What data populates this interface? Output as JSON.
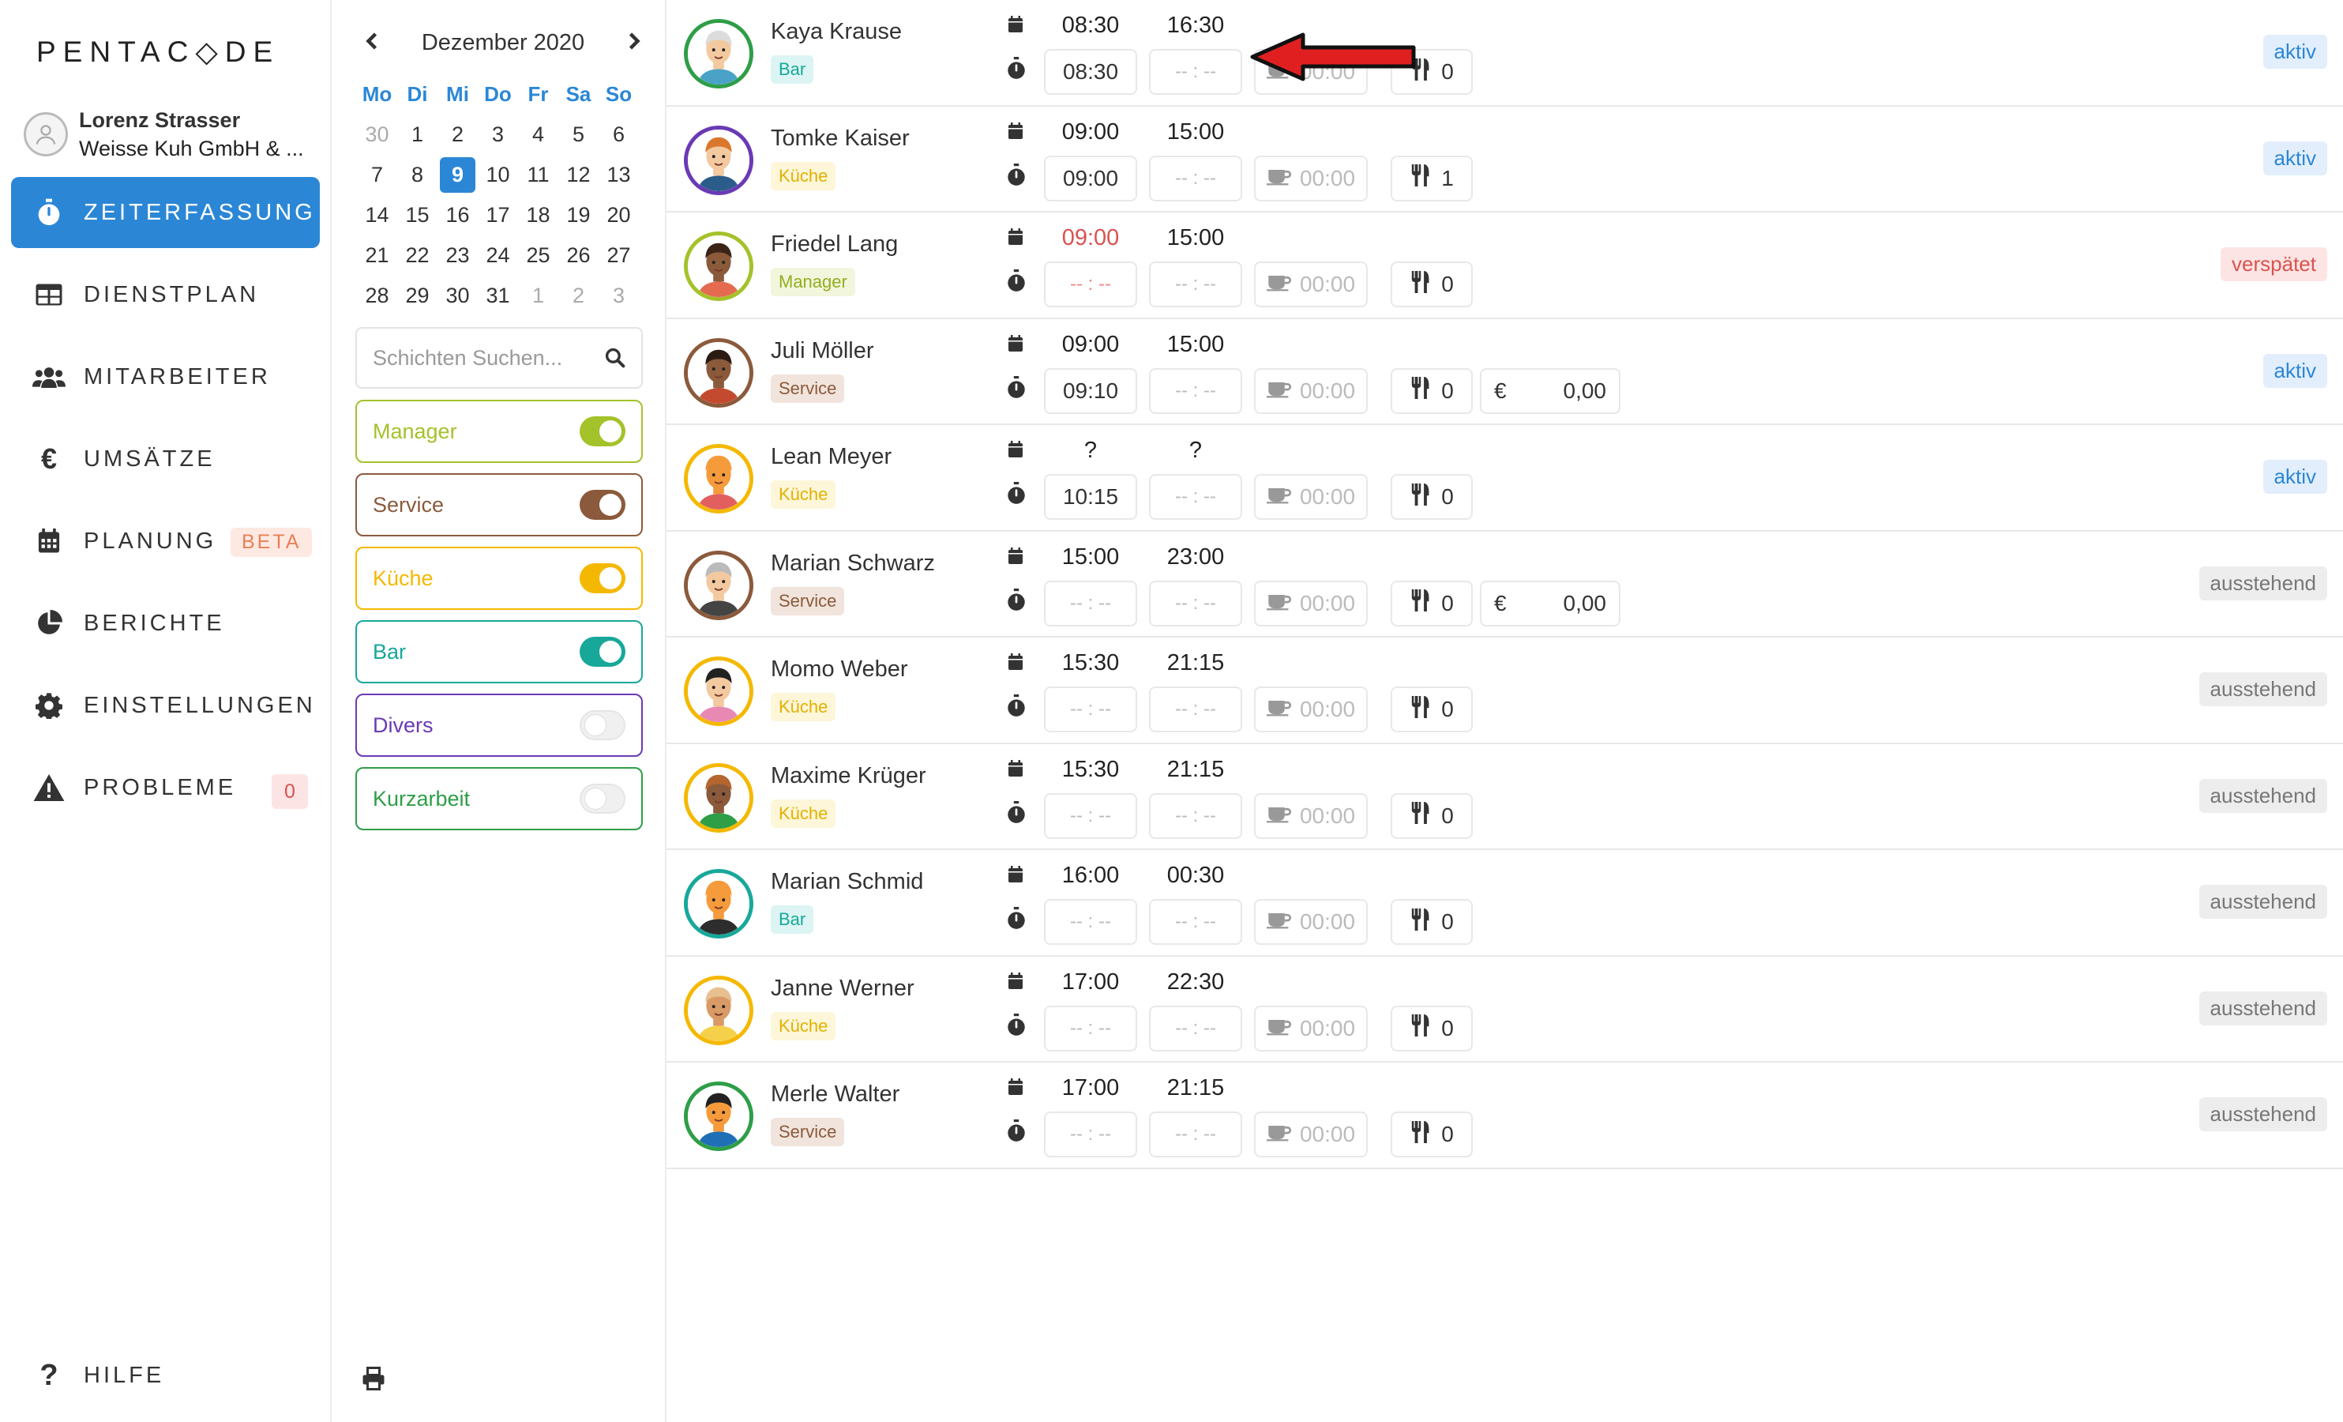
{
  "app": {
    "logo_text": "PENTAC◇DE",
    "accent_color": "#2b87d6"
  },
  "user": {
    "name": "Lorenz Strasser",
    "company": "Weisse Kuh GmbH & ..."
  },
  "nav": [
    {
      "id": "zeiterfassung",
      "label": "ZEITERFASSUNG",
      "icon": "stopwatch-icon",
      "active": true
    },
    {
      "id": "dienstplan",
      "label": "DIENSTPLAN",
      "icon": "table-icon"
    },
    {
      "id": "mitarbeiter",
      "label": "MITARBEITER",
      "icon": "users-icon"
    },
    {
      "id": "umsaetze",
      "label": "UMSÄTZE",
      "icon": "euro-icon"
    },
    {
      "id": "planung",
      "label": "PLANUNG",
      "icon": "calendar-icon",
      "badge": "BETA"
    },
    {
      "id": "berichte",
      "label": "BERICHTE",
      "icon": "pie-chart-icon"
    },
    {
      "id": "einstellungen",
      "label": "EINSTELLUNGEN",
      "icon": "gear-icon"
    },
    {
      "id": "probleme",
      "label": "PROBLEME",
      "icon": "warning-icon",
      "badge": "0"
    }
  ],
  "help": {
    "label": "HILFE",
    "icon": "question-icon"
  },
  "calendar": {
    "title": "Dezember 2020",
    "day_names": [
      "Mo",
      "Di",
      "Mi",
      "Do",
      "Fr",
      "Sa",
      "So"
    ],
    "weeks": [
      [
        "30",
        "1",
        "2",
        "3",
        "4",
        "5",
        "6"
      ],
      [
        "7",
        "8",
        "9",
        "10",
        "11",
        "12",
        "13"
      ],
      [
        "14",
        "15",
        "16",
        "17",
        "18",
        "19",
        "20"
      ],
      [
        "21",
        "22",
        "23",
        "24",
        "25",
        "26",
        "27"
      ],
      [
        "28",
        "29",
        "30",
        "31",
        "1",
        "2",
        "3"
      ]
    ],
    "selected_day": "9"
  },
  "search": {
    "placeholder": "Schichten Suchen..."
  },
  "filters": [
    {
      "label": "Manager",
      "color": "#a4c22a",
      "on": true
    },
    {
      "label": "Service",
      "color": "#8b5a3c",
      "on": true
    },
    {
      "label": "Küche",
      "color": "#f5b800",
      "on": true
    },
    {
      "label": "Bar",
      "color": "#17a89a",
      "on": true
    },
    {
      "label": "Divers",
      "color": "#6a3ab5",
      "on": false
    },
    {
      "label": "Kurzarbeit",
      "color": "#2e9e47",
      "on": false
    }
  ],
  "rows": [
    {
      "name": "Kaya Krause",
      "dept": "Bar",
      "ring": "#2e9e47",
      "plan_start": "08:30",
      "plan_end": "16:30",
      "actual_start": "08:30",
      "actual_end": "-- : --",
      "break": "00:00",
      "meals": "0",
      "status": "aktiv",
      "status_type": "aktiv"
    },
    {
      "name": "Tomke Kaiser",
      "dept": "Küche",
      "ring": "#6a3ab5",
      "plan_start": "09:00",
      "plan_end": "15:00",
      "actual_start": "09:00",
      "actual_end": "-- : --",
      "break": "00:00",
      "meals": "1",
      "status": "aktiv",
      "status_type": "aktiv"
    },
    {
      "name": "Friedel Lang",
      "dept": "Manager",
      "ring": "#a4c22a",
      "plan_start": "09:00",
      "plan_start_late": true,
      "plan_end": "15:00",
      "actual_start": "-- : --",
      "actual_end": "-- : --",
      "break": "00:00",
      "meals": "0",
      "status": "verspätet",
      "status_type": "verspaetet"
    },
    {
      "name": "Juli Möller",
      "dept": "Service",
      "ring": "#8b5a3c",
      "plan_start": "09:00",
      "plan_end": "15:00",
      "actual_start": "09:10",
      "actual_end": "-- : --",
      "break": "00:00",
      "meals": "0",
      "currency": "€",
      "amount": "0,00",
      "status": "aktiv",
      "status_type": "aktiv"
    },
    {
      "name": "Lean Meyer",
      "dept": "Küche",
      "ring": "#f5b800",
      "plan_start": "?",
      "plan_end": "?",
      "actual_start": "10:15",
      "actual_end": "-- : --",
      "break": "00:00",
      "meals": "0",
      "status": "aktiv",
      "status_type": "aktiv"
    },
    {
      "name": "Marian Schwarz",
      "dept": "Service",
      "ring": "#8b5a3c",
      "plan_start": "15:00",
      "plan_end": "23:00",
      "actual_start": "-- : --",
      "actual_end": "-- : --",
      "break": "00:00",
      "meals": "0",
      "currency": "€",
      "amount": "0,00",
      "status": "ausstehend",
      "status_type": "ausstehend"
    },
    {
      "name": "Momo Weber",
      "dept": "Küche",
      "ring": "#f5b800",
      "plan_start": "15:30",
      "plan_end": "21:15",
      "actual_start": "-- : --",
      "actual_end": "-- : --",
      "break": "00:00",
      "meals": "0",
      "status": "ausstehend",
      "status_type": "ausstehend"
    },
    {
      "name": "Maxime Krüger",
      "dept": "Küche",
      "ring": "#f5b800",
      "plan_start": "15:30",
      "plan_end": "21:15",
      "actual_start": "-- : --",
      "actual_end": "-- : --",
      "break": "00:00",
      "meals": "0",
      "status": "ausstehend",
      "status_type": "ausstehend"
    },
    {
      "name": "Marian Schmid",
      "dept": "Bar",
      "ring": "#17a89a",
      "plan_start": "16:00",
      "plan_end": "00:30",
      "actual_start": "-- : --",
      "actual_end": "-- : --",
      "break": "00:00",
      "meals": "0",
      "status": "ausstehend",
      "status_type": "ausstehend"
    },
    {
      "name": "Janne Werner",
      "dept": "Küche",
      "ring": "#f5b800",
      "plan_start": "17:00",
      "plan_end": "22:30",
      "actual_start": "-- : --",
      "actual_end": "-- : --",
      "break": "00:00",
      "meals": "0",
      "status": "ausstehend",
      "status_type": "ausstehend"
    },
    {
      "name": "Merle Walter",
      "dept": "Service",
      "ring": "#2e9e47",
      "plan_start": "17:00",
      "plan_end": "21:15",
      "actual_start": "-- : --",
      "actual_end": "-- : --",
      "break": "00:00",
      "meals": "0",
      "status": "ausstehend",
      "status_type": "ausstehend"
    }
  ],
  "dept_colors": {
    "Bar": {
      "bg": "#dcf4f3",
      "fg": "#17a89a"
    },
    "Küche": {
      "bg": "#fdf6d9",
      "fg": "#e2b100"
    },
    "Manager": {
      "bg": "#f1f6dc",
      "fg": "#93ae1f"
    },
    "Service": {
      "bg": "#f1e4dc",
      "fg": "#8b5a3c"
    }
  },
  "late_color": "#d9534f"
}
